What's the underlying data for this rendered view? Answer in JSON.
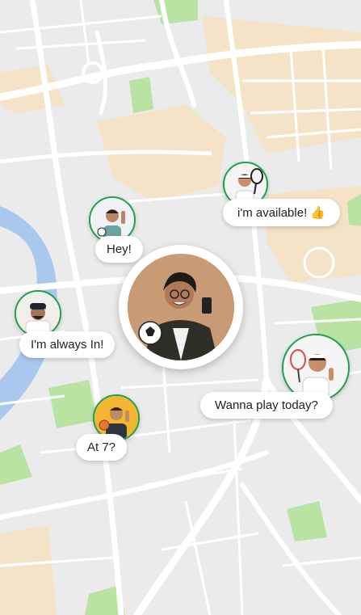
{
  "map": {
    "background_color": "#ebebeb",
    "water_color": "#aac8ee",
    "park_color": "#b9e3a3",
    "sand_color": "#f4e3c7"
  },
  "center_user": {
    "avatar": "man-with-soccer-ball-photo",
    "ring_color": "#ffffff"
  },
  "players": [
    {
      "avatar": "man-waving-photo",
      "message": "Hey!"
    },
    {
      "avatar": "man-in-turban-photo",
      "message": "I'm always In!"
    },
    {
      "avatar": "man-holding-basketball-photo",
      "message": "At 7?"
    },
    {
      "avatar": "woman-with-tennis-racket-photo",
      "message": "i'm available! 👍"
    },
    {
      "avatar": "woman-with-badminton-racket-photo",
      "message": "Wanna play today?"
    }
  ],
  "accent_color": "#1f9d4a"
}
